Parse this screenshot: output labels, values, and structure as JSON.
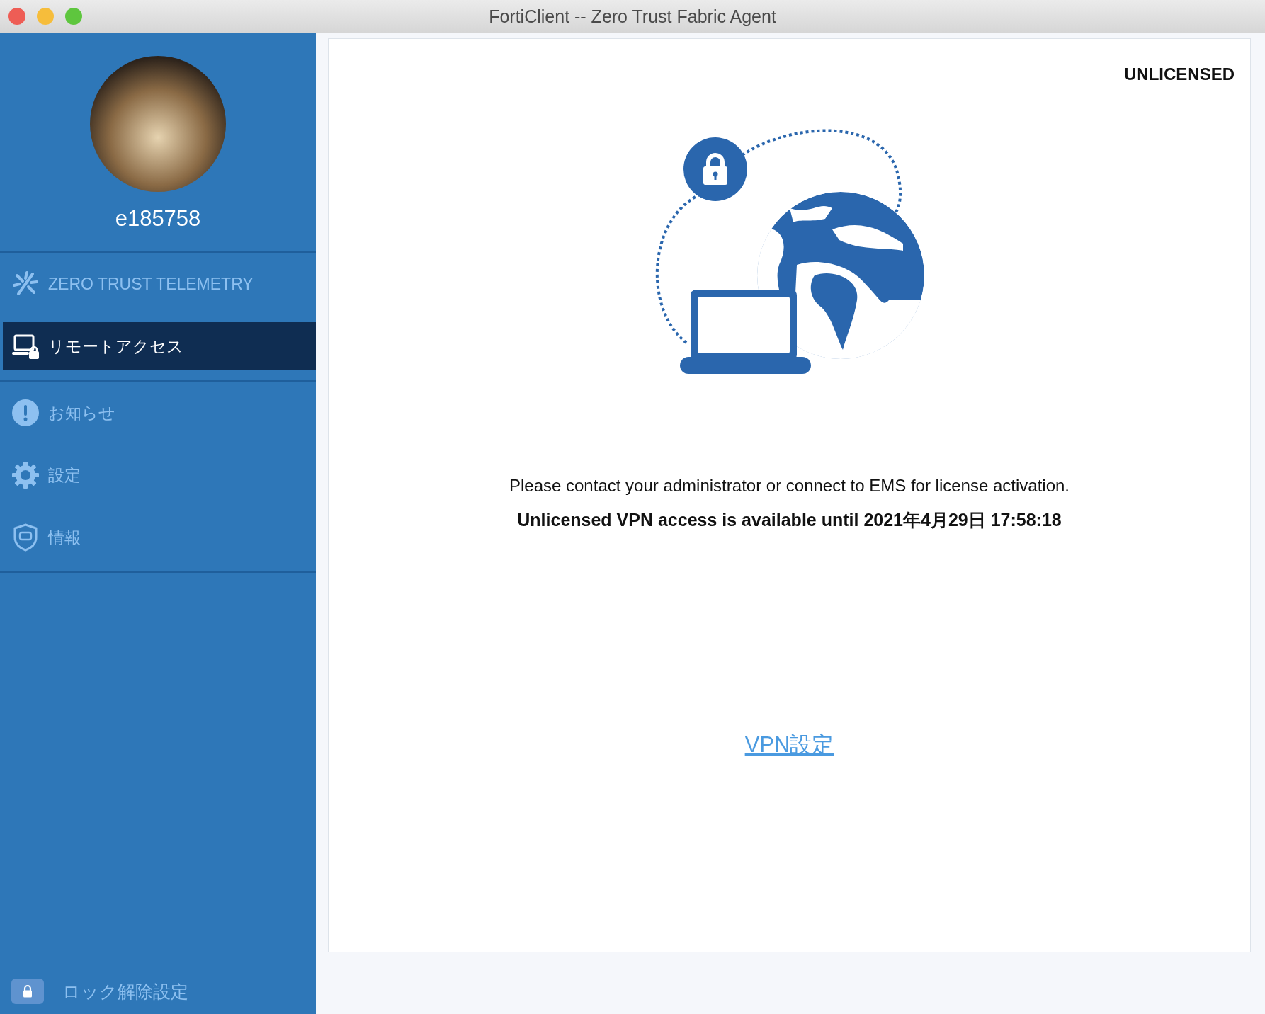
{
  "window": {
    "title": "FortiClient -- Zero Trust Fabric Agent"
  },
  "sidebar": {
    "username": "e185758",
    "sections": [
      {
        "items": [
          {
            "label": "ZERO TRUST TELEMETRY",
            "selected": false
          },
          {
            "label": "リモートアクセス",
            "selected": true
          }
        ]
      },
      {
        "items": [
          {
            "label": "お知らせ",
            "selected": false
          },
          {
            "label": "設定",
            "selected": false
          },
          {
            "label": "情報",
            "selected": false
          }
        ]
      }
    ],
    "unlock_settings": "ロック解除設定"
  },
  "main": {
    "license_badge": "UNLICENSED",
    "message": "Please contact your administrator or connect to EMS for license activation.",
    "notice": "Unlicensed VPN access is available until 2021年4月29日 17:58:18",
    "vpn_link": "VPN設定"
  }
}
